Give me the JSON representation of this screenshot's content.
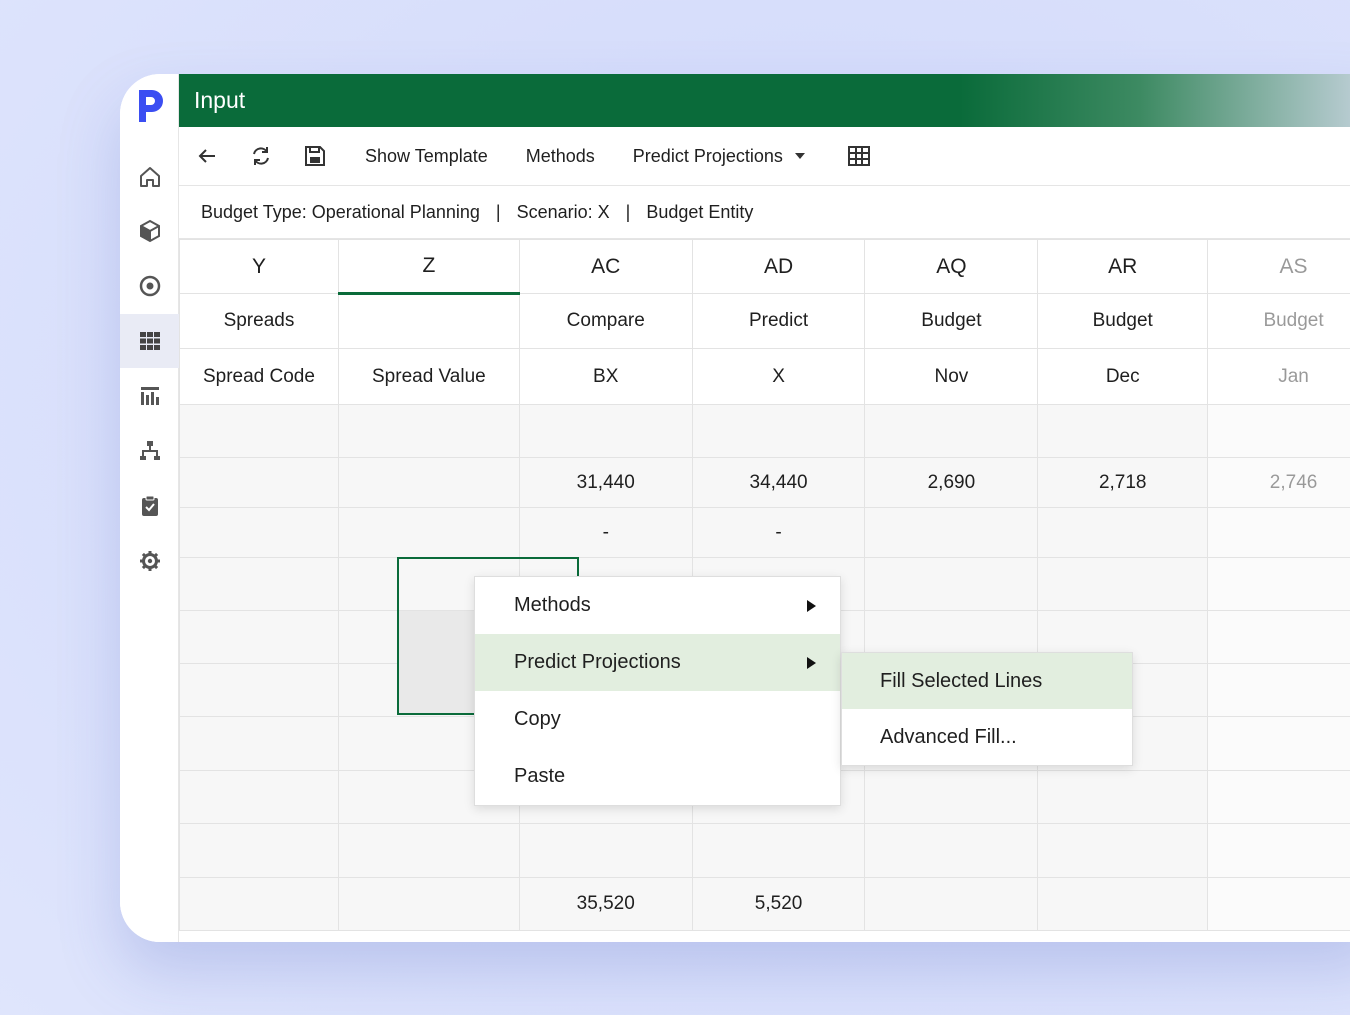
{
  "title": "Input",
  "toolbar": {
    "show_template": "Show Template",
    "methods": "Methods",
    "predict_projections": "Predict Projections"
  },
  "infobar": {
    "budget_type": "Budget Type: Operational Planning",
    "scenario": "Scenario: X",
    "entity": "Budget Entity",
    "separator": "|"
  },
  "grid": {
    "columns": [
      "Y",
      "Z",
      "AC",
      "AD",
      "AQ",
      "AR",
      "AS"
    ],
    "row2": [
      "Spreads",
      "",
      "Compare",
      "Predict",
      "Budget",
      "Budget",
      "Budget"
    ],
    "row3": [
      "Spread Code",
      "Spread Value",
      "BX",
      "X",
      "Nov",
      "Dec",
      "Jan"
    ],
    "body": [
      [
        "",
        "",
        "",
        "",
        "",
        "",
        ""
      ],
      [
        "",
        "",
        "31,440",
        "34,440",
        "2,690",
        "2,718",
        "2,746"
      ],
      [
        "",
        "",
        "-",
        "-",
        "",
        "",
        ""
      ],
      [
        "",
        "",
        "",
        "",
        "",
        "",
        ""
      ],
      [
        "",
        "",
        "",
        "",
        "",
        "",
        ""
      ],
      [
        "",
        "",
        "",
        "",
        "",
        "",
        ""
      ],
      [
        "",
        "",
        "",
        "",
        "",
        "",
        ""
      ],
      [
        "",
        "",
        "",
        "",
        "",
        "",
        ""
      ],
      [
        "",
        "",
        "",
        "",
        "",
        "",
        ""
      ],
      [
        "",
        "",
        "35,520",
        "5,520",
        "",
        "",
        ""
      ]
    ]
  },
  "context_menu": {
    "items": [
      "Methods",
      "Predict Projections",
      "Copy",
      "Paste"
    ]
  },
  "submenu": {
    "items": [
      "Fill Selected Lines",
      "Advanced Fill..."
    ]
  },
  "colors": {
    "accent": "#0a6b3a",
    "highlight": "#e2eedf",
    "logo": "#3b4ef2"
  }
}
